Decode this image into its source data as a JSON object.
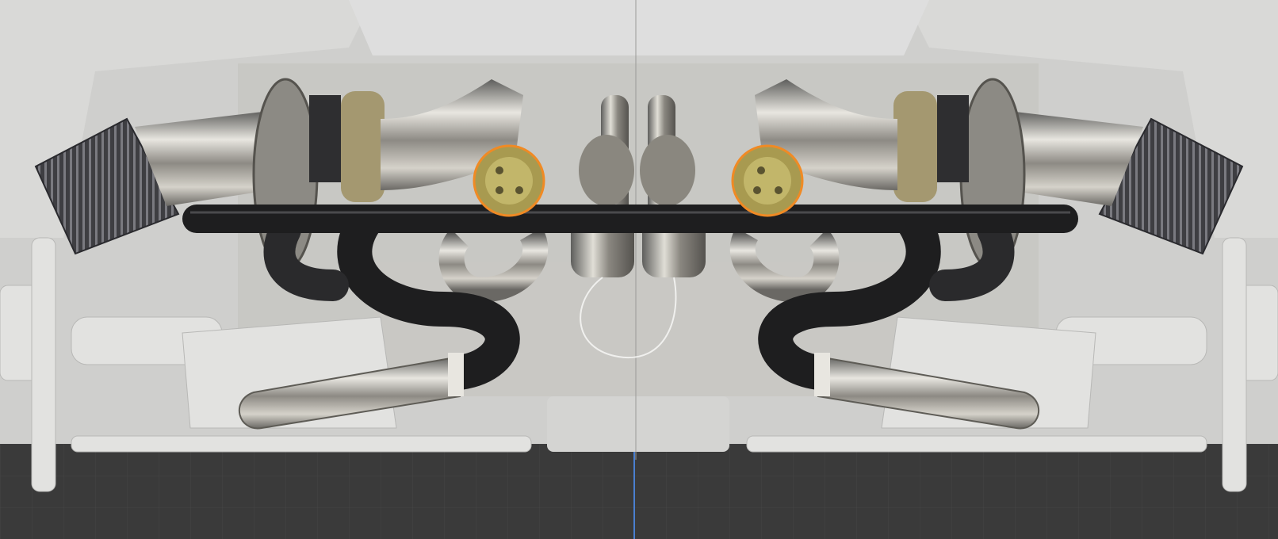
{
  "viewport": {
    "background": "#3a3a3a",
    "grid_color": "#444444",
    "center_axis_color": "#4a7fd0",
    "selection_outline_color": "#f08a24"
  },
  "scene": {
    "objects": [
      {
        "name": "engine-block",
        "color": "#d4d4d2"
      },
      {
        "name": "air-filter-left",
        "color": "#4a4a4e"
      },
      {
        "name": "air-filter-right",
        "color": "#4a4a4e"
      },
      {
        "name": "turbo-left",
        "color": "#8c8a84"
      },
      {
        "name": "turbo-right",
        "color": "#8c8a84"
      },
      {
        "name": "intercooler-pipe",
        "color": "#1e1e1f"
      },
      {
        "name": "exhaust-downpipe-left",
        "color": "#b8b6b0"
      },
      {
        "name": "exhaust-downpipe-right",
        "color": "#b8b6b0"
      },
      {
        "name": "wastegate-left",
        "color": "#a89a50",
        "selected": true
      },
      {
        "name": "wastegate-right",
        "color": "#a89a50",
        "selected": true
      },
      {
        "name": "suspension-arm-left",
        "color": "#e2e2e0"
      },
      {
        "name": "suspension-arm-right",
        "color": "#e2e2e0"
      }
    ]
  }
}
